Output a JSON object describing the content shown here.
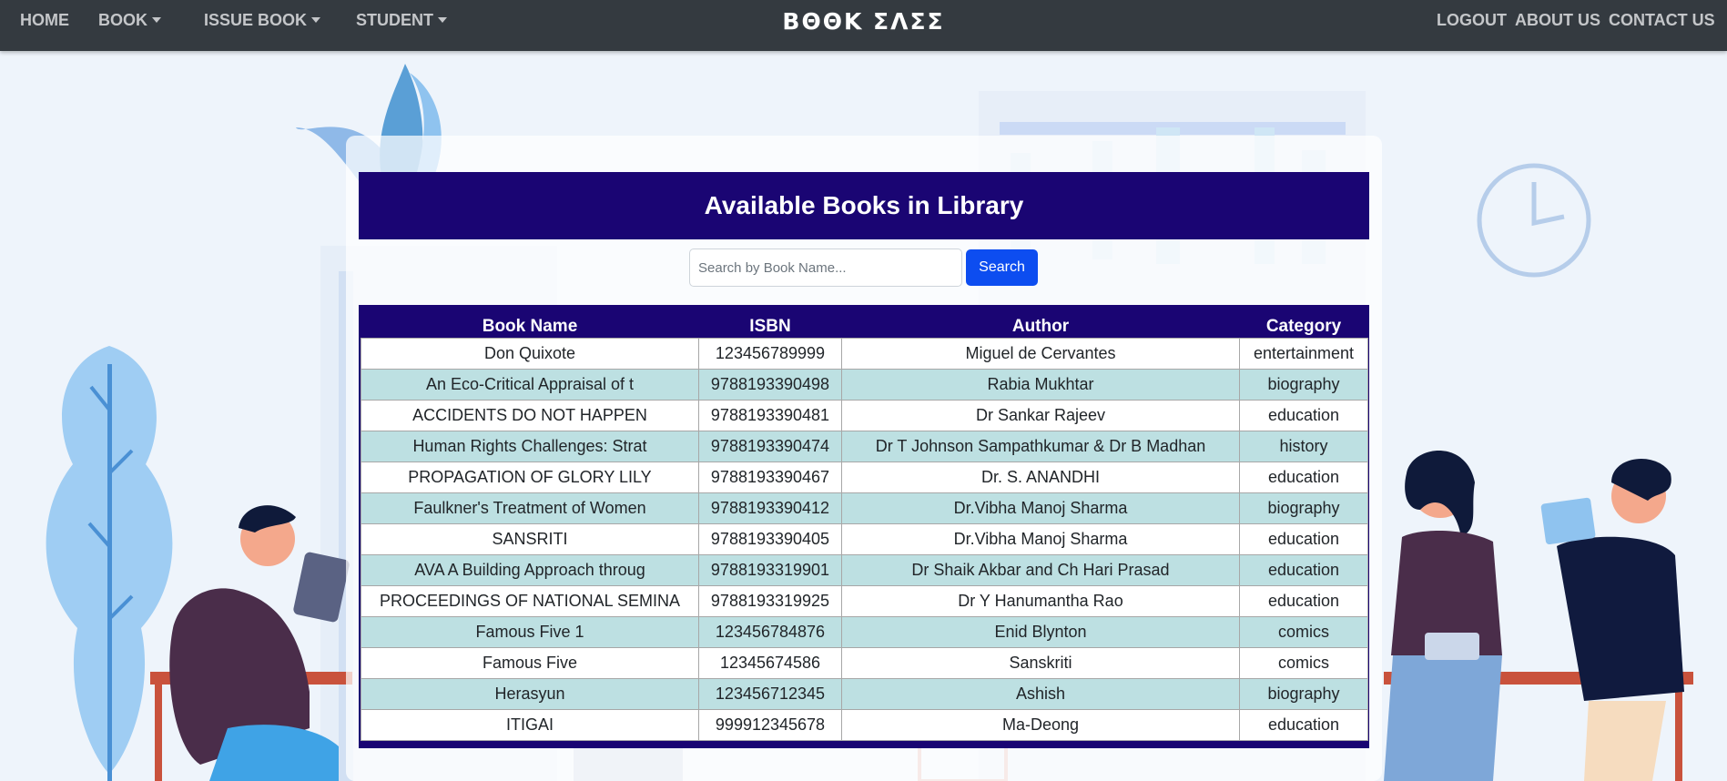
{
  "navbar": {
    "home": "HOME",
    "book": "BOOK",
    "issue_book": "ISSUE BOOK",
    "student": "STUDENT",
    "brand": "ΒΘΘΚ ΣΛΣΣ",
    "logout": "LOGOUT",
    "about": "ABOUT US",
    "contact": "CONTACT US"
  },
  "main": {
    "title": "Available Books in Library",
    "search_placeholder": "Search by Book Name...",
    "search_button": "Search"
  },
  "table": {
    "headers": [
      "Book Name",
      "ISBN",
      "Author",
      "Category"
    ],
    "rows": [
      [
        "Don Quixote",
        "123456789999",
        "Miguel de Cervantes",
        "entertainment"
      ],
      [
        "An Eco-Critical Appraisal of t",
        "9788193390498",
        "Rabia Mukhtar",
        "biography"
      ],
      [
        "ACCIDENTS DO NOT HAPPEN",
        "9788193390481",
        "Dr Sankar Rajeev",
        "education"
      ],
      [
        "Human Rights Challenges: Strat",
        "9788193390474",
        "Dr T Johnson Sampathkumar & Dr B Madhan",
        "history"
      ],
      [
        "PROPAGATION OF GLORY LILY",
        "9788193390467",
        "Dr. S. ANANDHI",
        "education"
      ],
      [
        "Faulkner's Treatment of Women",
        "9788193390412",
        "Dr.Vibha Manoj Sharma",
        "biography"
      ],
      [
        "SANSRITI",
        "9788193390405",
        "Dr.Vibha Manoj Sharma",
        "education"
      ],
      [
        "AVA A Building Approach throug",
        "9788193319901",
        "Dr Shaik Akbar and Ch Hari Prasad",
        "education"
      ],
      [
        "PROCEEDINGS OF NATIONAL SEMINA",
        "9788193319925",
        "Dr Y Hanumantha Rao",
        "education"
      ],
      [
        "Famous Five 1",
        "123456784876",
        "Enid Blynton",
        "comics"
      ],
      [
        "Famous Five",
        "12345674586",
        "Sanskriti",
        "comics"
      ],
      [
        "Herasyun",
        "123456712345",
        "Ashish",
        "biography"
      ],
      [
        "ITIGAI",
        "999912345678",
        "Ma-Deong",
        "education"
      ]
    ]
  },
  "colors": {
    "navbar": "#343a40",
    "header_bg": "#1a0573",
    "row_alt": "#bde0e2",
    "search_button": "#0d4df0"
  }
}
